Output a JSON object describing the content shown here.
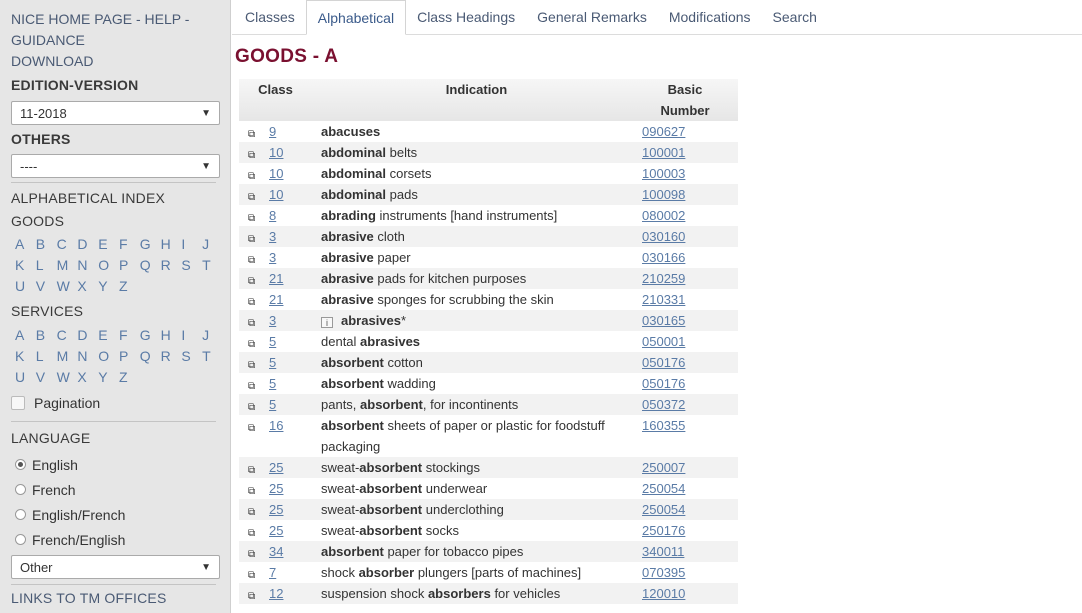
{
  "sidebar": {
    "nav_links": [
      "NICE HOME PAGE - HELP -",
      "GUIDANCE",
      "DOWNLOAD"
    ],
    "edition_heading": "EDITION-VERSION",
    "edition_value": "11-2018",
    "others_heading": "OTHERS",
    "others_value": "----",
    "alpha_heading": "ALPHABETICAL INDEX",
    "goods_heading": "GOODS",
    "services_heading": "SERVICES",
    "letters": [
      "A",
      "B",
      "C",
      "D",
      "E",
      "F",
      "G",
      "H",
      "I",
      "J",
      "K",
      "L",
      "M",
      "N",
      "O",
      "P",
      "Q",
      "R",
      "S",
      "T",
      "U",
      "V",
      "W",
      "X",
      "Y",
      "Z"
    ],
    "pagination_label": "Pagination",
    "language_heading": "LANGUAGE",
    "languages": [
      {
        "label": "English",
        "selected": true
      },
      {
        "label": "French",
        "selected": false
      },
      {
        "label": "English/French",
        "selected": false
      },
      {
        "label": "French/English",
        "selected": false
      }
    ],
    "other_select_value": "Other",
    "links_heading": "LINKS TO TM OFFICES"
  },
  "tabs": [
    "Classes",
    "Alphabetical",
    "Class Headings",
    "General Remarks",
    "Modifications",
    "Search"
  ],
  "active_tab": 1,
  "page_title": "GOODS - A",
  "table": {
    "headers": {
      "class": "Class",
      "indication": "Indication",
      "basic_number_1": "Basic",
      "basic_number_2": "Number"
    },
    "rows": [
      {
        "class": "9",
        "pre": "",
        "bold": "abacuses",
        "post": "",
        "number": "090627"
      },
      {
        "class": "10",
        "pre": "",
        "bold": "abdominal",
        "post": " belts",
        "number": "100001"
      },
      {
        "class": "10",
        "pre": "",
        "bold": "abdominal",
        "post": " corsets",
        "number": "100003"
      },
      {
        "class": "10",
        "pre": "",
        "bold": "abdominal",
        "post": " pads",
        "number": "100098"
      },
      {
        "class": "8",
        "pre": "",
        "bold": "abrading",
        "post": " instruments [hand instruments]",
        "number": "080002"
      },
      {
        "class": "3",
        "pre": "",
        "bold": "abrasive",
        "post": " cloth",
        "number": "030160"
      },
      {
        "class": "3",
        "pre": "",
        "bold": "abrasive",
        "post": " paper",
        "number": "030166"
      },
      {
        "class": "21",
        "pre": "",
        "bold": "abrasive",
        "post": " pads for kitchen purposes",
        "number": "210259"
      },
      {
        "class": "21",
        "pre": "",
        "bold": "abrasive",
        "post": " sponges for scrubbing the skin",
        "number": "210331"
      },
      {
        "class": "3",
        "pre": "",
        "bold": "abrasives",
        "post": "*",
        "number": "030165",
        "info": true
      },
      {
        "class": "5",
        "pre": "dental ",
        "bold": "abrasives",
        "post": "",
        "number": "050001"
      },
      {
        "class": "5",
        "pre": "",
        "bold": "absorbent",
        "post": " cotton",
        "number": "050176"
      },
      {
        "class": "5",
        "pre": "",
        "bold": "absorbent",
        "post": " wadding",
        "number": "050176"
      },
      {
        "class": "5",
        "pre": "pants, ",
        "bold": "absorbent",
        "post": ", for incontinents",
        "number": "050372"
      },
      {
        "class": "16",
        "pre": "",
        "bold": "absorbent",
        "post": " sheets of paper or plastic for foodstuff packaging",
        "number": "160355"
      },
      {
        "class": "25",
        "pre": "sweat-",
        "bold": "absorbent",
        "post": " stockings",
        "number": "250007"
      },
      {
        "class": "25",
        "pre": "sweat-",
        "bold": "absorbent",
        "post": " underwear",
        "number": "250054"
      },
      {
        "class": "25",
        "pre": "sweat-",
        "bold": "absorbent",
        "post": " underclothing",
        "number": "250054"
      },
      {
        "class": "25",
        "pre": "sweat-",
        "bold": "absorbent",
        "post": " socks",
        "number": "250176"
      },
      {
        "class": "34",
        "pre": "",
        "bold": "absorbent",
        "post": " paper for tobacco pipes",
        "number": "340011"
      },
      {
        "class": "7",
        "pre": "shock ",
        "bold": "absorber",
        "post": " plungers [parts of machines]",
        "number": "070395"
      },
      {
        "class": "12",
        "pre": "suspension shock ",
        "bold": "absorbers",
        "post": " for vehicles",
        "number": "120010"
      }
    ]
  },
  "colors": {
    "title": "#7a1030",
    "link": "#5a7ba6",
    "sidebar_bg": "#e6e6e6"
  }
}
